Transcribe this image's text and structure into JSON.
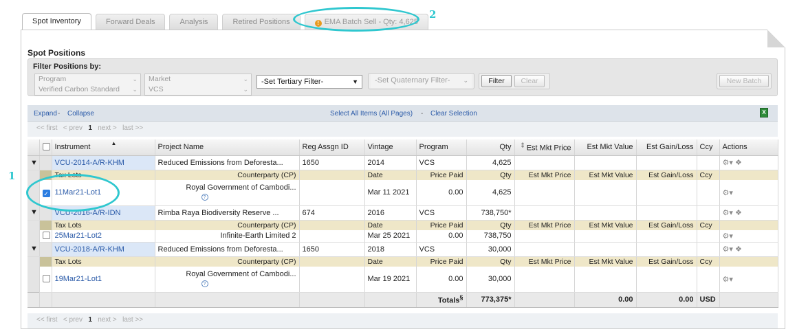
{
  "tabs": [
    {
      "label": "Spot Inventory",
      "active": true
    },
    {
      "label": "Forward Deals"
    },
    {
      "label": "Analysis"
    },
    {
      "label": "Retired Positions"
    },
    {
      "label": "EMA Batch Sell - Qty: 4,625"
    }
  ],
  "section_title": "Spot Positions",
  "filter": {
    "label": "Filter Positions by:",
    "program": {
      "label": "Program",
      "value": "Verified Carbon Standard"
    },
    "market": {
      "label": "Market",
      "value": "VCS"
    },
    "tertiary": "-Set Tertiary Filter-",
    "quaternary": "-Set Quaternary Filter-",
    "filter_btn": "Filter",
    "clear_btn": "Clear",
    "new_batch_btn": "New Batch"
  },
  "links": {
    "expand": "Expand",
    "dash": " - ",
    "collapse": "Collapse",
    "select_all": "Select All Items (All Pages)",
    "clear_sel": "Clear Selection"
  },
  "pager": {
    "first": "<< first",
    "prev": "< prev",
    "page": "1",
    "next": "next >",
    "last": "last >>"
  },
  "columns": {
    "instrument": "Instrument",
    "project": "Project Name",
    "reg": "Reg Assgn ID",
    "vintage": "Vintage",
    "program": "Program",
    "qty": "Qty",
    "est_price": "Est Mkt Price",
    "est_value": "Est Mkt Value",
    "est_gain": "Est Gain/Loss",
    "ccy": "Ccy",
    "actions": "Actions",
    "price_mark": "‡"
  },
  "lot_cols": {
    "tax_lots": "Tax Lots",
    "cp": "Counterparty (CP)",
    "date": "Date",
    "price_paid": "Price Paid",
    "qty": "Qty",
    "est_price": "Est Mkt Price",
    "est_value": "Est Mkt Value",
    "est_gain": "Est Gain/Loss",
    "ccy": "Ccy"
  },
  "groups": [
    {
      "instrument": "VCU-2014-A/R-KHM",
      "project": "Reduced Emissions from Deforesta...",
      "reg": "1650",
      "vintage": "2014",
      "program": "VCS",
      "qty": "4,625",
      "lot": {
        "name": "11Mar21-Lot1",
        "cp": "Royal Government of Cambodi...",
        "date": "Mar 11 2021",
        "price": "0.00",
        "qty": "4,625",
        "checked": true
      }
    },
    {
      "instrument": "VCU-2016-A/R-IDN",
      "project": "Rimba Raya Biodiversity Reserve ...",
      "reg": "674",
      "vintage": "2016",
      "program": "VCS",
      "qty": "738,750*",
      "lot": {
        "name": "25Mar21-Lot2",
        "cp": "Infinite-Earth Limited 2",
        "date": "Mar 25 2021",
        "price": "0.00",
        "qty": "738,750",
        "checked": false
      }
    },
    {
      "instrument": "VCU-2018-A/R-KHM",
      "project": "Reduced Emissions from Deforesta...",
      "reg": "1650",
      "vintage": "2018",
      "program": "VCS",
      "qty": "30,000",
      "lot": {
        "name": "19Mar21-Lot1",
        "cp": "Royal Government of Cambodi...",
        "date": "Mar 19 2021",
        "price": "0.00",
        "qty": "30,000",
        "checked": false
      }
    }
  ],
  "totals": {
    "label": "Totals",
    "mark": "§",
    "qty": "773,375*",
    "value": "0.00",
    "gain": "0.00",
    "ccy": "USD"
  },
  "annotations": {
    "one": "1",
    "two": "2"
  },
  "colors": {
    "highlight": "#2fc7cf",
    "link": "#2a5aa8",
    "lot_header": "#efe7c8"
  },
  "icons": {
    "warning": "warning-icon",
    "excel": "excel-export-icon",
    "gear": "gear-menu-icon",
    "tag": "tag-icon",
    "help": "help-icon"
  }
}
